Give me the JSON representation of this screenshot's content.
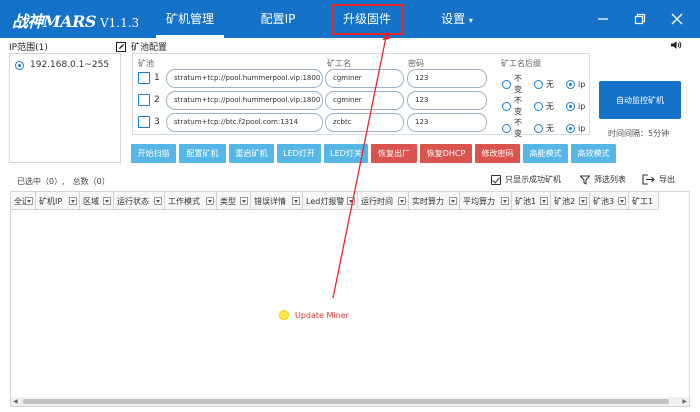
{
  "brand": {
    "logo": "战神MARS",
    "version": "V1.1.3"
  },
  "nav": [
    {
      "label": "矿机管理",
      "active": true
    },
    {
      "label": "配置IP",
      "active": false
    },
    {
      "label": "升级固件",
      "active": false,
      "highlighted": true
    },
    {
      "label": "设置",
      "active": false,
      "dropdown": "▾"
    }
  ],
  "window": {
    "min": "—",
    "restore": "❐",
    "close": "✕"
  },
  "left": {
    "title": "IP范围(1)",
    "items": [
      {
        "label": "192.168.0.1~255",
        "selected": true
      }
    ]
  },
  "pool": {
    "title": "矿池配置",
    "col_pool": "矿池",
    "col_worker": "矿工名",
    "col_password": "密码",
    "col_suffix": "矿工名后缀",
    "suffix_options": [
      "不变",
      "无",
      "ip"
    ],
    "rows": [
      {
        "num": "1",
        "url": "stratum+tcp://pool.hummerpool.vip:1800",
        "worker": "cgminer",
        "password": "123",
        "suffix": "ip"
      },
      {
        "num": "2",
        "url": "stratum+tcp://pool.hummerpool.vip:1800",
        "worker": "cgminer",
        "password": "123",
        "suffix": "ip"
      },
      {
        "num": "3",
        "url": "stratum+tcp://btc.f2pool.com:1314",
        "worker": "zcbtc",
        "password": "123",
        "suffix": "ip"
      }
    ]
  },
  "auto_button": "自动监控矿机",
  "interval": "时间间隔：5分钟",
  "actions": [
    {
      "label": "开始扫描",
      "style": "blue"
    },
    {
      "label": "配置矿机",
      "style": "blue"
    },
    {
      "label": "重启矿机",
      "style": "blue"
    },
    {
      "label": "LED灯开",
      "style": "blue"
    },
    {
      "label": "LED灯关",
      "style": "blue"
    },
    {
      "label": "恢复出厂",
      "style": "red"
    },
    {
      "label": "恢复DHCP",
      "style": "red"
    },
    {
      "label": "修改密码",
      "style": "red"
    },
    {
      "label": "高能模式",
      "style": "blue"
    },
    {
      "label": "高效模式",
      "style": "blue"
    }
  ],
  "status": {
    "selected": "已选中（0）,",
    "total": "总数（0）"
  },
  "toolbar": {
    "only_success": "只显示成功矿机",
    "filter": "筛选列表",
    "export": "导出"
  },
  "columns": [
    "全选",
    "矿机IP",
    "区域",
    "运行状态",
    "工作模式",
    "类型",
    "错误详情",
    "Led灯报警",
    "运行时间",
    "实时算力",
    "平均算力",
    "矿池1",
    "矿池2",
    "矿池3",
    "矿工1"
  ],
  "annotation": {
    "label": "Update Miner",
    "color": "#e8262e"
  },
  "colors": {
    "primary": "#1473c8",
    "action_blue": "#56b6e6",
    "action_red": "#d9534f",
    "annotation": "#e8262e"
  }
}
